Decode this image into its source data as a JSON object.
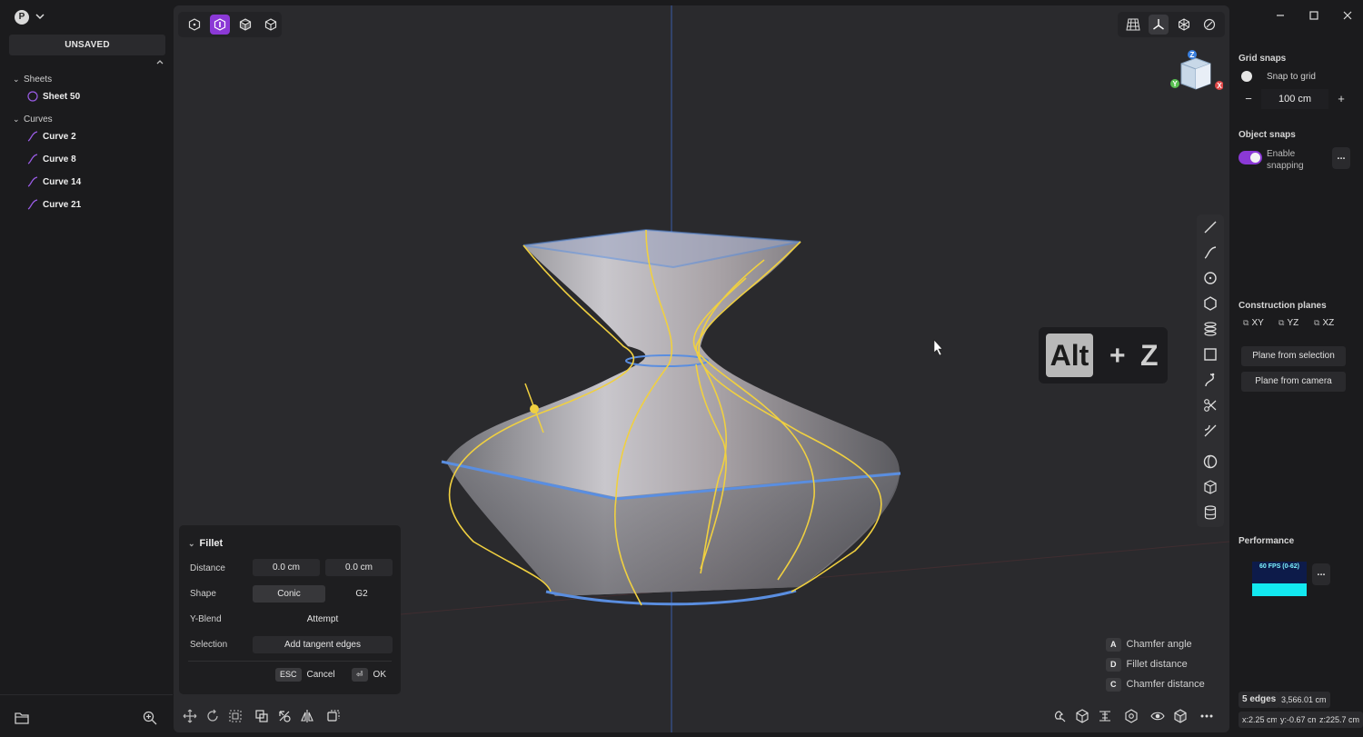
{
  "account": {
    "initial": "P"
  },
  "document": {
    "status": "UNSAVED"
  },
  "tree": {
    "sheets_label": "Sheets",
    "sheets": [
      {
        "label": "Sheet 50"
      }
    ],
    "curves_label": "Curves",
    "curves": [
      {
        "label": "Curve 2"
      },
      {
        "label": "Curve 8"
      },
      {
        "label": "Curve 14"
      },
      {
        "label": "Curve 21"
      }
    ]
  },
  "viewport": {
    "selection_modes": [
      "vertex-mode-icon",
      "face-mode-icon",
      "solid-mode-icon",
      "object-mode-icon"
    ],
    "active_selection_mode": "face-mode-icon",
    "view_toggles": [
      "grid-icon",
      "axes-icon",
      "wireframe-icon",
      "overlay-icon"
    ],
    "orientation_cube": {
      "z": "Z",
      "y": "Y",
      "x": "X"
    },
    "shortcut_overlay": {
      "key1": "Alt",
      "plus": "+",
      "key2": "Z"
    },
    "accent_color": "#8b39d6",
    "curve_color": "#f0d040",
    "edge_color": "#4a8ae0"
  },
  "fillet": {
    "title": "Fillet",
    "distance_label": "Distance",
    "distance_1": "0.0 cm",
    "distance_2": "0.0 cm",
    "shape_label": "Shape",
    "shape_conic": "Conic",
    "shape_g2": "G2",
    "yblend_label": "Y-Blend",
    "yblend_value": "Attempt",
    "selection_label": "Selection",
    "selection_value": "Add tangent edges",
    "cancel_key": "ESC",
    "cancel_label": "Cancel",
    "ok_key": "⏎",
    "ok_label": "OK"
  },
  "hints": [
    {
      "key": "A",
      "label": "Chamfer angle"
    },
    {
      "key": "D",
      "label": "Fillet distance"
    },
    {
      "key": "C",
      "label": "Chamfer distance"
    }
  ],
  "right_panel": {
    "grid_snaps_title": "Grid snaps",
    "snap_to_grid_label": "Snap to grid",
    "grid_size_value": "100 cm",
    "grid_minus": "−",
    "grid_plus": "+",
    "object_snaps_title": "Object snaps",
    "enable_snapping_line1": "Enable",
    "enable_snapping_line2": "snapping",
    "more": "...",
    "construction_planes_title": "Construction planes",
    "planes": [
      "XY",
      "YZ",
      "XZ"
    ],
    "plane_from_selection": "Plane from selection",
    "plane_from_camera": "Plane from camera",
    "performance_title": "Performance",
    "fps_label": "60 FPS (0-62)",
    "stats": {
      "edges": "5 edges",
      "length": "3,566.01 cm",
      "x": "x:2.25 cm",
      "y": "y:-0.67 cm",
      "z": "z:225.7 cm"
    }
  }
}
